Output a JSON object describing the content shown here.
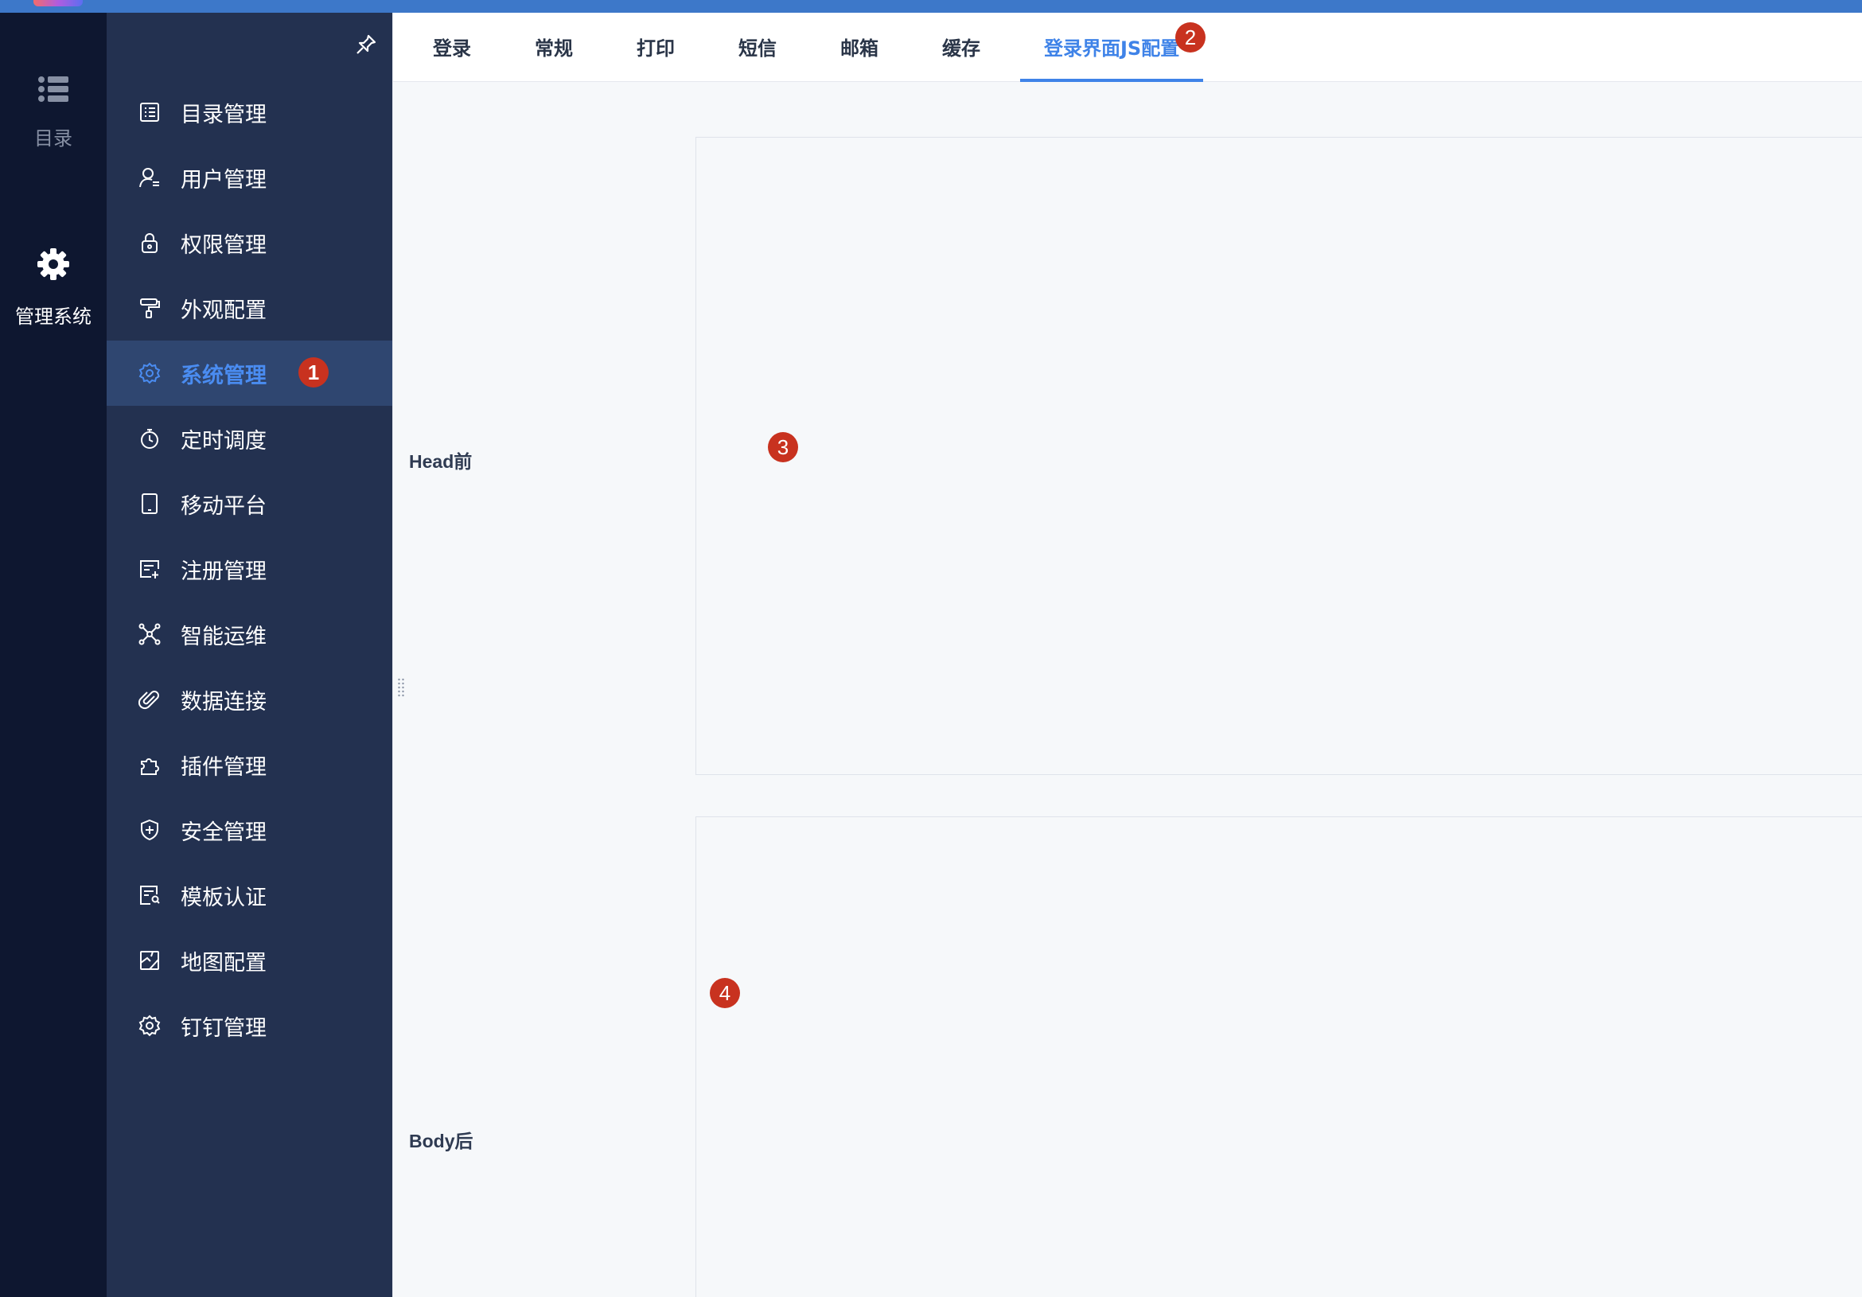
{
  "rail": {
    "items": [
      {
        "label": "目录",
        "icon": "list-icon"
      },
      {
        "label": "管理系统",
        "icon": "gear-icon"
      }
    ]
  },
  "sidebar": {
    "items": [
      {
        "label": "目录管理",
        "icon": "catalog-icon"
      },
      {
        "label": "用户管理",
        "icon": "user-manage-icon"
      },
      {
        "label": "权限管理",
        "icon": "lock-icon"
      },
      {
        "label": "外观配置",
        "icon": "paint-roller-icon"
      },
      {
        "label": "系统管理",
        "icon": "gear-icon",
        "active": true
      },
      {
        "label": "定时调度",
        "icon": "stopwatch-icon"
      },
      {
        "label": "移动平台",
        "icon": "tablet-icon"
      },
      {
        "label": "注册管理",
        "icon": "register-icon"
      },
      {
        "label": "智能运维",
        "icon": "network-icon"
      },
      {
        "label": "数据连接",
        "icon": "paperclip-icon"
      },
      {
        "label": "插件管理",
        "icon": "puzzle-icon"
      },
      {
        "label": "安全管理",
        "icon": "shield-plus-icon"
      },
      {
        "label": "模板认证",
        "icon": "template-cert-icon"
      },
      {
        "label": "地图配置",
        "icon": "map-icon"
      },
      {
        "label": "钉钉管理",
        "icon": "gear-outline-icon"
      }
    ]
  },
  "tabs": [
    {
      "label": "登录"
    },
    {
      "label": "常规"
    },
    {
      "label": "打印"
    },
    {
      "label": "短信"
    },
    {
      "label": "邮箱"
    },
    {
      "label": "缓存"
    },
    {
      "label": "登录界面JS配置",
      "active": true
    }
  ],
  "fields": {
    "head_before": "Head前",
    "body_after": "Body后"
  },
  "annotations": [
    "1",
    "2",
    "3",
    "4"
  ],
  "colors": {
    "accent": "#3f83e8",
    "rail_bg": "#0e1730",
    "sidebar_bg": "#233150",
    "active_item_bg": "#2f4670",
    "badge": "#c8321f",
    "topbar": "#3d78c9"
  }
}
